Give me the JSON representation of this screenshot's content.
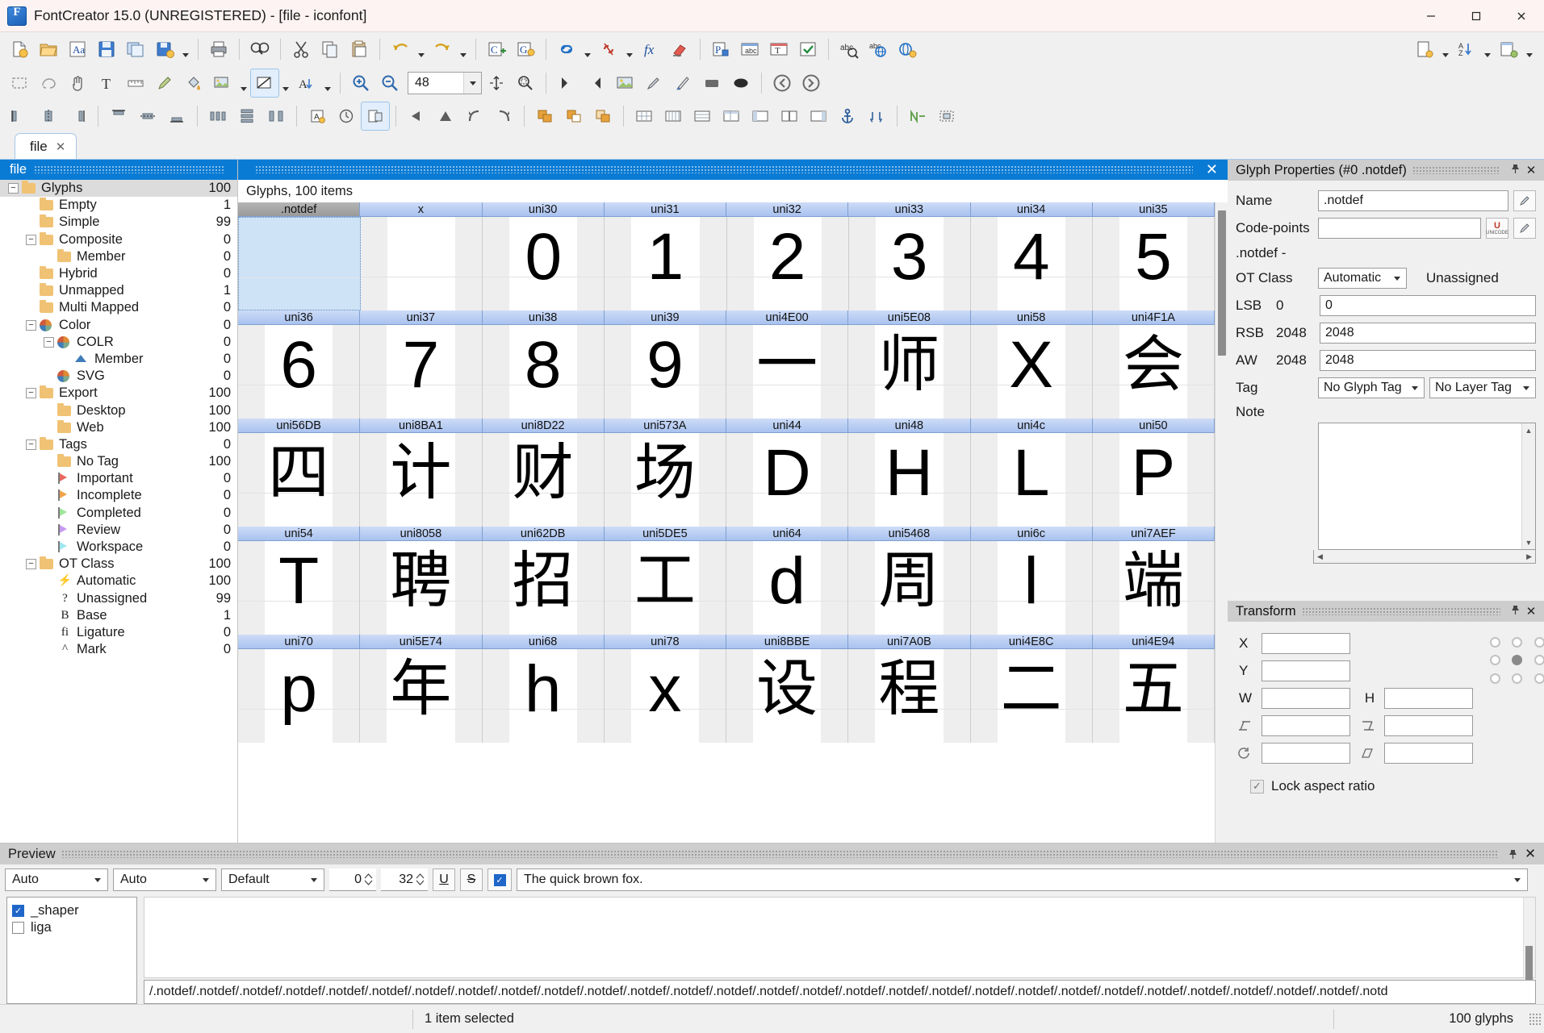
{
  "window": {
    "title": "FontCreator 15.0 (UNREGISTERED) - [file - iconfont]",
    "minimize": "─",
    "maximize": "☐",
    "close": "✕"
  },
  "document_tab": {
    "label": "file",
    "close": "✕"
  },
  "toolbar_zoom": {
    "value": "48"
  },
  "left_panel": {
    "caption": "file",
    "items": [
      {
        "label": "Glyphs",
        "count": "100",
        "indent": 0,
        "icon": "folder-icon",
        "expander": "minus",
        "selected": true
      },
      {
        "label": "Empty",
        "count": "1",
        "indent": 1,
        "icon": "folder-icon",
        "expander": "none"
      },
      {
        "label": "Simple",
        "count": "99",
        "indent": 1,
        "icon": "folder-icon",
        "expander": "none"
      },
      {
        "label": "Composite",
        "count": "0",
        "indent": 1,
        "icon": "folder-icon",
        "expander": "minus"
      },
      {
        "label": "Member",
        "count": "0",
        "indent": 2,
        "icon": "folder-icon",
        "expander": "none"
      },
      {
        "label": "Hybrid",
        "count": "0",
        "indent": 1,
        "icon": "folder-icon",
        "expander": "none"
      },
      {
        "label": "Unmapped",
        "count": "1",
        "indent": 1,
        "icon": "folder-icon",
        "expander": "none"
      },
      {
        "label": "Multi Mapped",
        "count": "0",
        "indent": 1,
        "icon": "folder-icon",
        "expander": "none"
      },
      {
        "label": "Color",
        "count": "0",
        "indent": 1,
        "icon": "color-pie-icon",
        "expander": "minus"
      },
      {
        "label": "COLR",
        "count": "0",
        "indent": 2,
        "icon": "color-pie-icon",
        "expander": "minus"
      },
      {
        "label": "Member",
        "count": "0",
        "indent": 3,
        "icon": "triangle-icon",
        "expander": "none"
      },
      {
        "label": "SVG",
        "count": "0",
        "indent": 2,
        "icon": "color-pie-icon",
        "expander": "none"
      },
      {
        "label": "Export",
        "count": "100",
        "indent": 1,
        "icon": "folder-icon",
        "expander": "minus"
      },
      {
        "label": "Desktop",
        "count": "100",
        "indent": 2,
        "icon": "folder-icon",
        "expander": "none"
      },
      {
        "label": "Web",
        "count": "100",
        "indent": 2,
        "icon": "folder-icon",
        "expander": "none"
      },
      {
        "label": "Tags",
        "count": "0",
        "indent": 1,
        "icon": "folder-icon",
        "expander": "minus"
      },
      {
        "label": "No Tag",
        "count": "100",
        "indent": 2,
        "icon": "folder-icon",
        "expander": "none"
      },
      {
        "label": "Important",
        "count": "0",
        "indent": 2,
        "icon": "flag-icon",
        "expander": "none",
        "flag_color": "#e8685e"
      },
      {
        "label": "Incomplete",
        "count": "0",
        "indent": 2,
        "icon": "flag-icon",
        "expander": "none",
        "flag_color": "#f0a44a"
      },
      {
        "label": "Completed",
        "count": "0",
        "indent": 2,
        "icon": "flag-icon",
        "expander": "none",
        "flag_color": "#9fe59b"
      },
      {
        "label": "Review",
        "count": "0",
        "indent": 2,
        "icon": "flag-icon",
        "expander": "none",
        "flag_color": "#c79bf0"
      },
      {
        "label": "Workspace",
        "count": "0",
        "indent": 2,
        "icon": "flag-icon",
        "expander": "none",
        "flag_color": "#9fe8ef"
      },
      {
        "label": "OT Class",
        "count": "100",
        "indent": 1,
        "icon": "folder-icon",
        "expander": "minus"
      },
      {
        "label": "Automatic",
        "count": "100",
        "indent": 2,
        "icon": "bolt-icon",
        "expander": "none",
        "mark": "⚡"
      },
      {
        "label": "Unassigned",
        "count": "99",
        "indent": 2,
        "icon": "question-icon",
        "expander": "none",
        "mark": "?"
      },
      {
        "label": "Base",
        "count": "1",
        "indent": 2,
        "icon": "letter-b-icon",
        "expander": "none",
        "mark": "B"
      },
      {
        "label": "Ligature",
        "count": "0",
        "indent": 2,
        "icon": "ligature-icon",
        "expander": "none",
        "mark": "fi"
      },
      {
        "label": "Mark",
        "count": "0",
        "indent": 2,
        "icon": "caret-up-icon",
        "expander": "none",
        "mark": "^"
      }
    ]
  },
  "glyph_panel": {
    "caption": "file",
    "close": "✕",
    "subtitle": "Glyphs, 100 items",
    "rows": [
      {
        "headers": [
          ".notdef",
          "x",
          "uni30",
          "uni31",
          "uni32",
          "uni33",
          "uni34",
          "uni35"
        ],
        "glyphs": [
          "",
          "",
          "0",
          "1",
          "2",
          "3",
          "4",
          "5"
        ],
        "selected_index": 0
      },
      {
        "headers": [
          "uni36",
          "uni37",
          "uni38",
          "uni39",
          "uni4E00",
          "uni5E08",
          "uni58",
          "uni4F1A"
        ],
        "glyphs": [
          "6",
          "7",
          "8",
          "9",
          "一",
          "师",
          "X",
          "会"
        ]
      },
      {
        "headers": [
          "uni56DB",
          "uni8BA1",
          "uni8D22",
          "uni573A",
          "uni44",
          "uni48",
          "uni4c",
          "uni50"
        ],
        "glyphs": [
          "四",
          "计",
          "财",
          "场",
          "D",
          "H",
          "L",
          "P"
        ]
      },
      {
        "headers": [
          "uni54",
          "uni8058",
          "uni62DB",
          "uni5DE5",
          "uni64",
          "uni5468",
          "uni6c",
          "uni7AEF"
        ],
        "glyphs": [
          "T",
          "聘",
          "招",
          "工",
          "d",
          "周",
          "l",
          "端"
        ]
      },
      {
        "headers": [
          "uni70",
          "uni5E74",
          "uni68",
          "uni78",
          "uni8BBE",
          "uni7A0B",
          "uni4E8C",
          "uni4E94"
        ],
        "glyphs": [
          "p",
          "年",
          "h",
          "x",
          "设",
          "程",
          "二",
          "五"
        ]
      }
    ]
  },
  "glyph_properties": {
    "title": "Glyph Properties (#0 .notdef)",
    "pin": "📌",
    "close": "✕",
    "name_label": "Name",
    "name_value": ".notdef",
    "codepoints_label": "Code-points",
    "codepoints_value": "",
    "notdef_line": ".notdef -",
    "otclass_label": "OT Class",
    "otclass_value": "Automatic",
    "otclass_status": "Unassigned",
    "lsb_label": "LSB",
    "lsb_static": "0",
    "lsb_value": "0",
    "rsb_label": "RSB",
    "rsb_static": "2048",
    "rsb_value": "2048",
    "aw_label": "AW",
    "aw_static": "2048",
    "aw_value": "2048",
    "tag_label": "Tag",
    "glyph_tag_value": "No Glyph Tag",
    "layer_tag_value": "No Layer Tag",
    "note_label": "Note",
    "note_value": ""
  },
  "transform": {
    "title": "Transform",
    "pin": "📌",
    "close": "✕",
    "x_label": "X",
    "x_value": "",
    "y_label": "Y",
    "y_value": "",
    "w_label": "W",
    "w_value": "",
    "h_label": "H",
    "h_value": "",
    "skew_h_value": "",
    "skew_v_value": "",
    "rotate_value": "",
    "shear_value": "",
    "lock_label": "Lock aspect ratio",
    "lock_checked": true
  },
  "preview": {
    "title": "Preview",
    "pin": "📌",
    "close": "✕",
    "script_value": "Auto",
    "language_value": "Auto",
    "feature_value": "Default",
    "spin1_value": "0",
    "spin2_value": "32",
    "underline_label": "U",
    "strike_label": "S",
    "sample_text": "The quick brown fox.",
    "features": [
      {
        "label": "_shaper",
        "checked": true
      },
      {
        "label": "liga",
        "checked": false
      }
    ],
    "notdef_string": "/.notdef/.notdef/.notdef/.notdef/.notdef/.notdef/.notdef/.notdef/.notdef/.notdef/.notdef/.notdef/.notdef/.notdef/.notdef/.notdef/.notdef/.notdef/.notdef/.notdef/.notdef/.notdef/.notdef/.notdef/.notdef/.notdef/.notdef/.notdef/.notd"
  },
  "statusbar": {
    "selection": "1 item selected",
    "glyph_count": "100 glyphs"
  },
  "colors": {
    "accent_blue": "#0a7bd4",
    "header_blue": "#a9c2ef",
    "folder_yellow": "#f0c274",
    "dock_header": "#cdcdcd"
  }
}
